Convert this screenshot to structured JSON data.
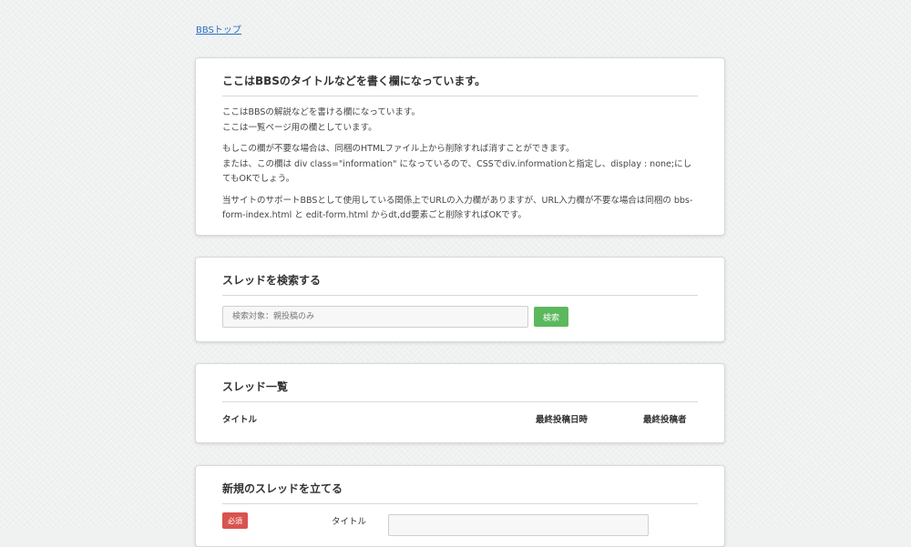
{
  "nav": {
    "top_link": "BBSトップ"
  },
  "info": {
    "title": "ここはBBSのタイトルなどを書く欄になっています。",
    "p1_l1": "ここはBBSの解説などを書ける欄になっています。",
    "p1_l2": "ここは一覧ページ用の欄としています。",
    "p2_l1": "もしこの欄が不要な場合は、同梱のHTMLファイル上から削除すれば消すことができます。",
    "p2_l2": "または、この欄は div class=\"information\" になっているので、CSSでdiv.informationと指定し、display : none;にしてもOKでしょう。",
    "p3": "当サイトのサポートBBSとして使用している関係上でURLの入力欄がありますが、URL入力欄が不要な場合は同梱の bbs-form-index.html と edit-form.html からdt,dd要素ごと削除すればOKです。"
  },
  "search": {
    "title": "スレッドを検索する",
    "placeholder": "検索対象：親投稿のみ",
    "button": "検索"
  },
  "list": {
    "title": "スレッド一覧",
    "columns": [
      "タイトル",
      "最終投稿日時",
      "最終投稿者"
    ]
  },
  "newthread": {
    "title": "新規のスレッドを立てる",
    "required_badge": "必須",
    "field_label": "タイトル",
    "field_value": ""
  },
  "colors": {
    "link": "#2a6ec2",
    "search_button": "#5cb85c",
    "required_badge": "#d9534f",
    "background": "#f0f1f1"
  }
}
